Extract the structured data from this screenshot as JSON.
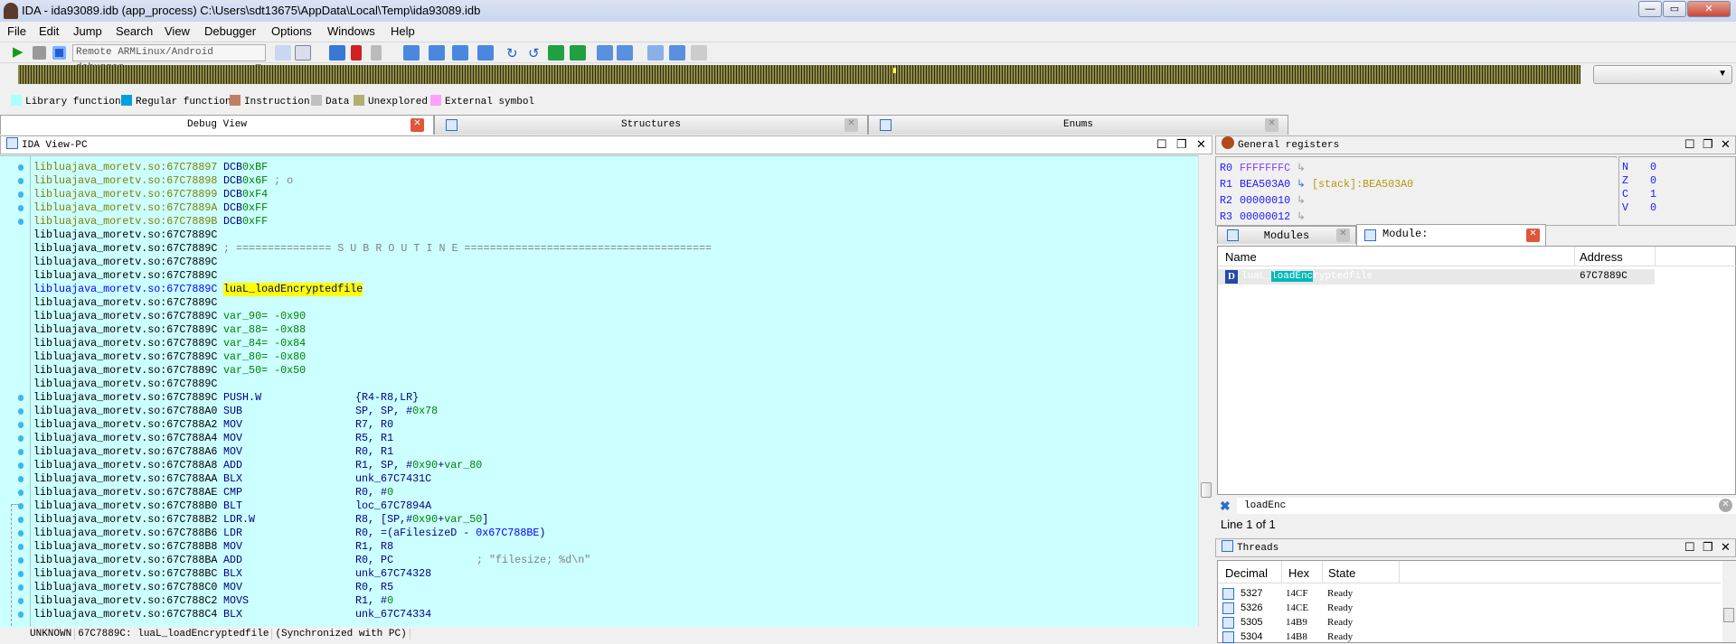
{
  "window": {
    "title": "IDA - ida93089.idb (app_process) C:\\Users\\sdt13675\\AppData\\Local\\Temp\\ida93089.idb",
    "minimize": "—",
    "maximize": "▭",
    "close": "✕"
  },
  "menu": [
    "File",
    "Edit",
    "Jump",
    "Search",
    "View",
    "Debugger",
    "Options",
    "Windows",
    "Help"
  ],
  "toolbar": {
    "debugger_select": "Remote ARMLinux/Android debugger"
  },
  "legend": [
    {
      "label": "Library function",
      "color": "#aaffff"
    },
    {
      "label": "Regular function",
      "color": "#00a0e0"
    },
    {
      "label": "Instruction",
      "color": "#c08060"
    },
    {
      "label": "Data",
      "color": "#c0c0c0"
    },
    {
      "label": "Unexplored",
      "color": "#b0b070"
    },
    {
      "label": "External symbol",
      "color": "#ffa0ff"
    }
  ],
  "tabs": [
    {
      "label": "Debug View",
      "active": true
    },
    {
      "label": "Structures"
    },
    {
      "label": "Enums"
    }
  ],
  "ida_view": {
    "title": "IDA View-PC",
    "lines": [
      {
        "addr": "libluajava_moretv.so:67C78897",
        "ac": "d",
        "dot": true,
        "mn": "DCB",
        "ops": [
          [
            "0xBF",
            "g"
          ]
        ]
      },
      {
        "addr": "libluajava_moretv.so:67C78898",
        "ac": "d",
        "dot": true,
        "mn": "DCB",
        "ops": [
          [
            "0x6F",
            "g"
          ],
          [
            " ; o",
            "c"
          ]
        ]
      },
      {
        "addr": "libluajava_moretv.so:67C78899",
        "ac": "d",
        "dot": true,
        "mn": "DCB",
        "ops": [
          [
            "0xF4",
            "g"
          ]
        ]
      },
      {
        "addr": "libluajava_moretv.so:67C7889A",
        "ac": "d",
        "dot": true,
        "mn": "DCB",
        "ops": [
          [
            "0xFF",
            "g"
          ]
        ]
      },
      {
        "addr": "libluajava_moretv.so:67C7889B",
        "ac": "d",
        "dot": true,
        "mn": "DCB",
        "ops": [
          [
            "0xFF",
            "g"
          ]
        ]
      },
      {
        "addr": "libluajava_moretv.so:67C7889C",
        "ac": "n"
      },
      {
        "addr": "libluajava_moretv.so:67C7889C",
        "ac": "n",
        "mn": "; =============== S U B R O U T I N E =======================================",
        "mnc": "c"
      },
      {
        "addr": "libluajava_moretv.so:67C7889C",
        "ac": "n"
      },
      {
        "addr": "libluajava_moretv.so:67C7889C",
        "ac": "n"
      },
      {
        "addr": "libluajava_moretv.so:67C7889C",
        "ac": "f",
        "mn": "luaL_loadEncryptedfile",
        "mnc": "y"
      },
      {
        "addr": "libluajava_moretv.so:67C7889C",
        "ac": "n"
      },
      {
        "addr": "libluajava_moretv.so:67C7889C",
        "ac": "n",
        "mn": "var_90= -0x90",
        "mnc": "g"
      },
      {
        "addr": "libluajava_moretv.so:67C7889C",
        "ac": "n",
        "mn": "var_88= -0x88",
        "mnc": "g"
      },
      {
        "addr": "libluajava_moretv.so:67C7889C",
        "ac": "n",
        "mn": "var_84= -0x84",
        "mnc": "g"
      },
      {
        "addr": "libluajava_moretv.so:67C7889C",
        "ac": "n",
        "mn": "var_80= -0x80",
        "mnc": "g"
      },
      {
        "addr": "libluajava_moretv.so:67C7889C",
        "ac": "n",
        "mn": "var_50= -0x50",
        "mnc": "g"
      },
      {
        "addr": "libluajava_moretv.so:67C7889C",
        "ac": "n"
      },
      {
        "addr": "libluajava_moretv.so:67C7889C",
        "ac": "n",
        "dot": true,
        "mn": "PUSH.W",
        "op": [
          [
            "{R4-R8,LR}",
            "n"
          ]
        ]
      },
      {
        "addr": "libluajava_moretv.so:67C788A0",
        "ac": "n",
        "dot": true,
        "mn": "SUB",
        "op": [
          [
            "SP, SP, #",
            "n"
          ],
          [
            "0x78",
            "g"
          ]
        ]
      },
      {
        "addr": "libluajava_moretv.so:67C788A2",
        "ac": "n",
        "dot": true,
        "mn": "MOV",
        "op": [
          [
            "R7, R0",
            "n"
          ]
        ]
      },
      {
        "addr": "libluajava_moretv.so:67C788A4",
        "ac": "n",
        "dot": true,
        "mn": "MOV",
        "op": [
          [
            "R5, R1",
            "n"
          ]
        ]
      },
      {
        "addr": "libluajava_moretv.so:67C788A6",
        "ac": "n",
        "dot": true,
        "mn": "MOV",
        "op": [
          [
            "R0, R1",
            "n"
          ]
        ]
      },
      {
        "addr": "libluajava_moretv.so:67C788A8",
        "ac": "n",
        "dot": true,
        "mn": "ADD",
        "op": [
          [
            "R1, SP, #",
            "n"
          ],
          [
            "0x90",
            "g"
          ],
          [
            "+",
            "n"
          ],
          [
            "var_80",
            "g"
          ]
        ]
      },
      {
        "addr": "libluajava_moretv.so:67C788AA",
        "ac": "n",
        "dot": true,
        "mn": "BLX",
        "op": [
          [
            "unk_67C7431C",
            "n"
          ]
        ]
      },
      {
        "addr": "libluajava_moretv.so:67C788AE",
        "ac": "n",
        "dot": true,
        "mn": "CMP",
        "op": [
          [
            "R0, #",
            "n"
          ],
          [
            "0",
            "g"
          ]
        ]
      },
      {
        "addr": "libluajava_moretv.so:67C788B0",
        "ac": "n",
        "dot": true,
        "mn": "BLT",
        "op": [
          [
            "loc_67C7894A",
            "n"
          ]
        ]
      },
      {
        "addr": "libluajava_moretv.so:67C788B2",
        "ac": "n",
        "dot": true,
        "mn": "LDR.W",
        "op": [
          [
            "R8, [SP,#",
            "n"
          ],
          [
            "0x90",
            "g"
          ],
          [
            "+",
            "n"
          ],
          [
            "var_50",
            "g"
          ],
          [
            "]",
            "n"
          ]
        ]
      },
      {
        "addr": "libluajava_moretv.so:67C788B6",
        "ac": "n",
        "dot": true,
        "mn": "LDR",
        "op": [
          [
            "R0, =(aFilesizeD - ",
            "n"
          ],
          [
            "0x67C788BE",
            "b"
          ],
          [
            ")",
            "n"
          ]
        ]
      },
      {
        "addr": "libluajava_moretv.so:67C788B8",
        "ac": "n",
        "dot": true,
        "mn": "MOV",
        "op": [
          [
            "R1, R8",
            "n"
          ]
        ]
      },
      {
        "addr": "libluajava_moretv.so:67C788BA",
        "ac": "n",
        "dot": true,
        "mn": "ADD",
        "op": [
          [
            "R0, PC",
            "n"
          ]
        ],
        "cm": "; \"filesize; %d\\n\""
      },
      {
        "addr": "libluajava_moretv.so:67C788BC",
        "ac": "n",
        "dot": true,
        "mn": "BLX",
        "op": [
          [
            "unk_67C74328",
            "n"
          ]
        ]
      },
      {
        "addr": "libluajava_moretv.so:67C788C0",
        "ac": "n",
        "dot": true,
        "mn": "MOV",
        "op": [
          [
            "R0, R5",
            "n"
          ]
        ]
      },
      {
        "addr": "libluajava_moretv.so:67C788C2",
        "ac": "n",
        "dot": true,
        "mn": "MOVS",
        "op": [
          [
            "R1, #",
            "n"
          ],
          [
            "0",
            "g"
          ]
        ]
      },
      {
        "addr": "libluajava_moretv.so:67C788C4",
        "ac": "n",
        "dot": true,
        "mn": "BLX",
        "op": [
          [
            "unk_67C74334",
            "n"
          ]
        ]
      }
    ],
    "status": {
      "mode": "UNKNOWN",
      "location": "67C7889C: luaL_loadEncryptedfile",
      "sync": "(Synchronized with PC)"
    }
  },
  "registers": {
    "title": "General registers",
    "rows": [
      {
        "name": "R0",
        "value": "FFFFFFFC",
        "ref": ""
      },
      {
        "name": "R1",
        "value": "BEA503A0",
        "ref": "[stack]:BEA503A0"
      },
      {
        "name": "R2",
        "value": "00000010",
        "ref": ""
      },
      {
        "name": "R3",
        "value": "00000012",
        "ref": ""
      }
    ],
    "flags": [
      {
        "name": "N",
        "value": "0"
      },
      {
        "name": "Z",
        "value": "0"
      },
      {
        "name": "C",
        "value": "1"
      },
      {
        "name": "V",
        "value": "0"
      }
    ]
  },
  "modules": {
    "tabs": [
      {
        "label": "Modules"
      },
      {
        "label": "Module: libluajava_moretv.so",
        "active": true
      }
    ],
    "columns": [
      "Name",
      "Address"
    ],
    "rows": [
      {
        "name": "luaL_loadEncryptedfile",
        "match_prefix": "luaL_",
        "match": "loadEnc",
        "match_suffix": "ryptedfile",
        "address": "67C7889C"
      }
    ],
    "search": "loadEnc",
    "line_info": "Line 1 of 1"
  },
  "threads": {
    "title": "Threads",
    "columns": [
      "Decimal",
      "Hex",
      "State"
    ],
    "rows": [
      {
        "dec": "5327",
        "hex": "14CF",
        "state": "Ready"
      },
      {
        "dec": "5326",
        "hex": "14CE",
        "state": "Ready"
      },
      {
        "dec": "5305",
        "hex": "14B9",
        "state": "Ready"
      },
      {
        "dec": "5304",
        "hex": "14B8",
        "state": "Ready"
      }
    ]
  }
}
